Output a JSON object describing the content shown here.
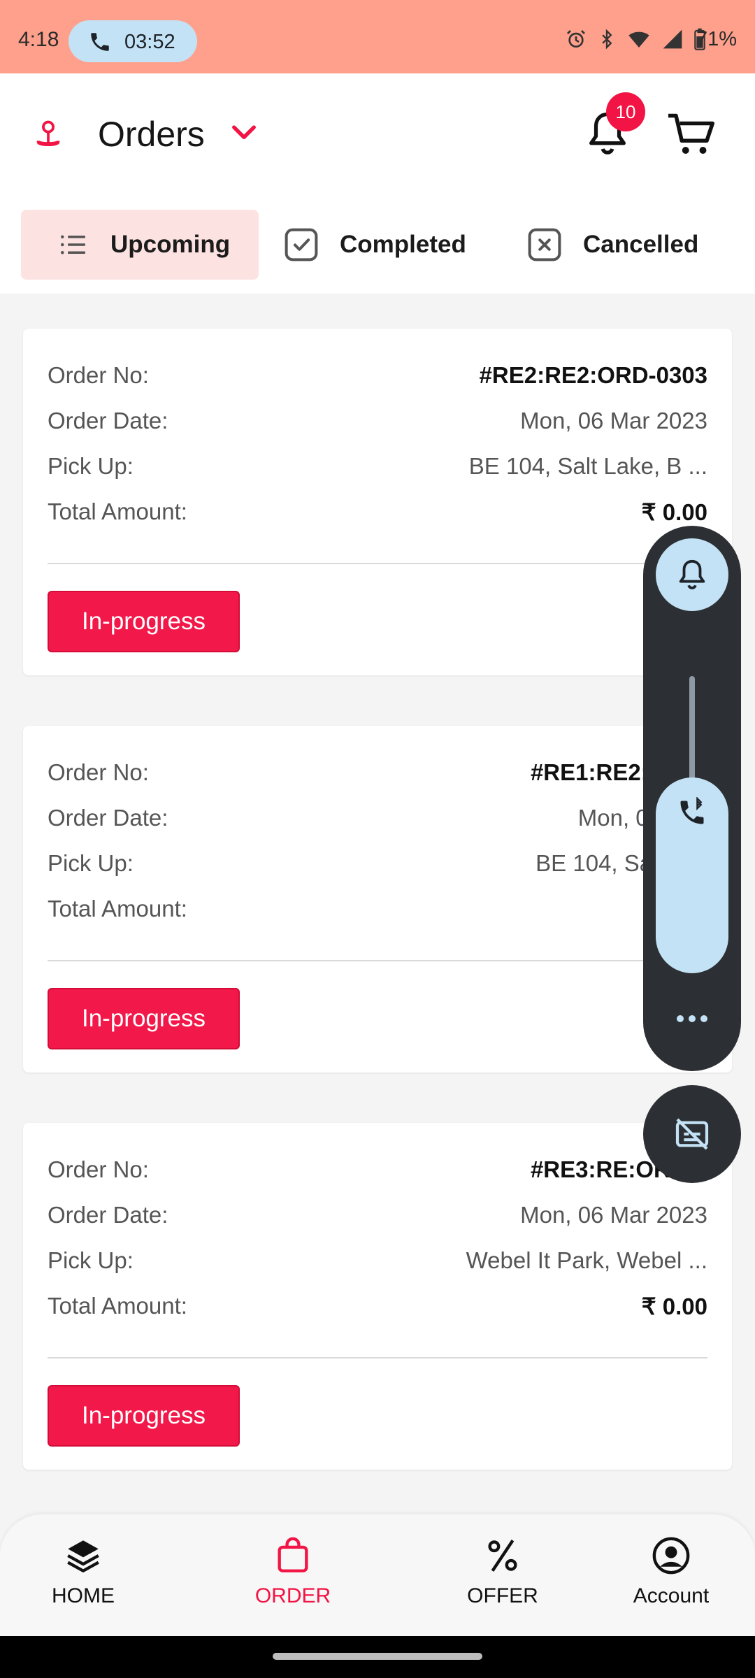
{
  "status_bar": {
    "time": "4:18",
    "call_timer": "03:52",
    "battery": "71%"
  },
  "header": {
    "title": "Orders",
    "notification_count": "10"
  },
  "tabs": [
    {
      "label": "Upcoming",
      "active": true
    },
    {
      "label": "Completed",
      "active": false
    },
    {
      "label": "Cancelled",
      "active": false
    }
  ],
  "labels": {
    "order_no": "Order No:",
    "order_date": "Order Date:",
    "pick_up": "Pick Up:",
    "total_amount": "Total Amount:"
  },
  "orders": [
    {
      "order_no": "#RE2:RE2:ORD-0303",
      "order_date": "Mon, 06 Mar 2023",
      "pick_up": "BE 104, Salt Lake, B ...",
      "total_amount": "₹ 0.00",
      "status": "In-progress"
    },
    {
      "order_no": "#RE1:RE2:ORD-",
      "order_date": "Mon, 06 Mar",
      "pick_up": "BE 104, Salt Lak",
      "total_amount": "₹",
      "status": "In-progress"
    },
    {
      "order_no": "#RE3:RE:ORD-0",
      "order_date": "Mon, 06 Mar 2023",
      "pick_up": "Webel It Park, Webel ...",
      "total_amount": "₹ 0.00",
      "status": "In-progress"
    }
  ],
  "bottom_nav": [
    {
      "label": "HOME",
      "icon": "layers-icon",
      "active": false
    },
    {
      "label": "ORDER",
      "icon": "shopping-bag-icon",
      "active": true
    },
    {
      "label": "OFFER",
      "icon": "percent-icon",
      "active": false
    },
    {
      "label": "Account",
      "icon": "account-circle-icon",
      "active": false
    }
  ],
  "colors": {
    "accent": "#f21444",
    "status_bar": "#fea08c",
    "tab_active_bg": "#fde2e2",
    "overlay_panel": "#2c3034",
    "overlay_accent": "#c4e2f5"
  }
}
